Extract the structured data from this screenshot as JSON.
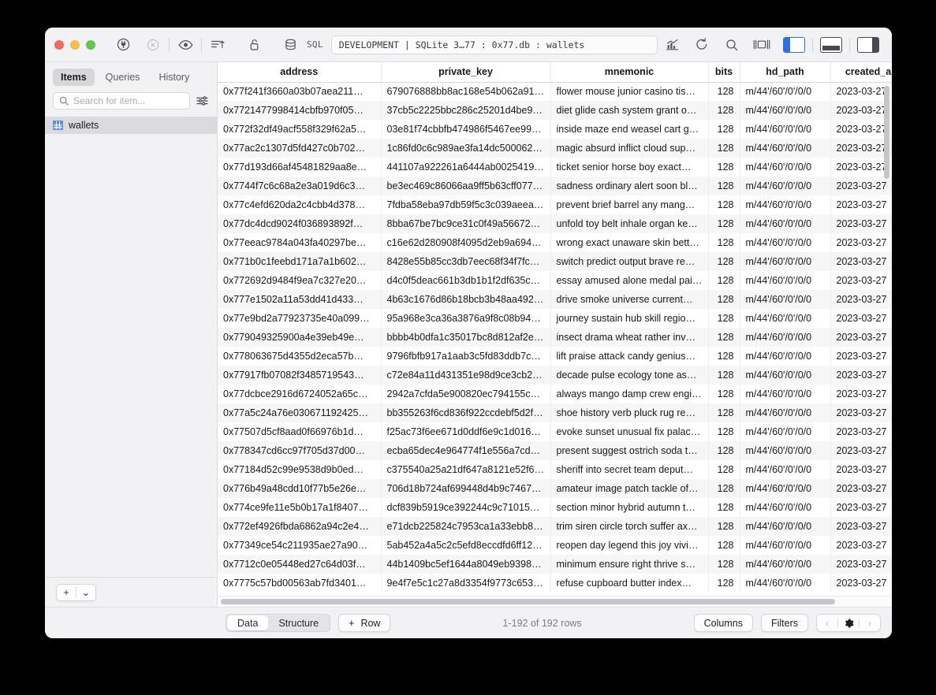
{
  "window": {
    "traffic_lights": [
      "close",
      "minimize",
      "maximize"
    ]
  },
  "toolbar": {
    "sql_label": "SQL",
    "address_value": "DEVELOPMENT | SQLite 3…77 : 0x77.db : wallets",
    "icons_left": [
      "connect-plug-icon",
      "stop-circle-icon",
      "eye-icon",
      "sort-ascending-icon",
      "unlock-icon",
      "database-icon"
    ],
    "icons_right": [
      "chart-icon",
      "refresh-icon",
      "search-icon",
      "center-panel-icon"
    ],
    "panel_toggles": [
      "left-panel-toggle",
      "bottom-panel-toggle",
      "right-panel-toggle"
    ]
  },
  "sidebar": {
    "tabs": [
      {
        "label": "Items",
        "active": true
      },
      {
        "label": "Queries",
        "active": false
      },
      {
        "label": "History",
        "active": false
      }
    ],
    "search": {
      "placeholder": "Search for item...",
      "value": ""
    },
    "filter_icon": "sliders-icon",
    "items": [
      {
        "label": "wallets",
        "icon": "table-grid-icon",
        "selected": true
      }
    ],
    "footer": {
      "add_label": "+",
      "chevron": "⌄"
    }
  },
  "table": {
    "columns": [
      {
        "key": "address",
        "label": "address"
      },
      {
        "key": "private_key",
        "label": "private_key"
      },
      {
        "key": "mnemonic",
        "label": "mnemonic"
      },
      {
        "key": "bits",
        "label": "bits"
      },
      {
        "key": "hd_path",
        "label": "hd_path"
      },
      {
        "key": "created_at",
        "label": "created_a"
      }
    ],
    "rows": [
      {
        "address": "0x77f241f3660a03b07aea211…",
        "private_key": "679076888bb8ac168e54b062a918…",
        "mnemonic": "flower mouse junior casino tis…",
        "bits": "128",
        "hd_path": "m/44'/60'/0'/0/0",
        "created_at": "2023-03-27"
      },
      {
        "address": "0x7721477998414cbfb970f05…",
        "private_key": "37cb5c2225bbc286c25201d4be966…",
        "mnemonic": "diet glide cash system grant o…",
        "bits": "128",
        "hd_path": "m/44'/60'/0'/0/0",
        "created_at": "2023-03-27"
      },
      {
        "address": "0x772f32df49acf558f329f62a5…",
        "private_key": "03e81f74cbbfb474986f5467ee99cb…",
        "mnemonic": "inside maze end weasel cart g…",
        "bits": "128",
        "hd_path": "m/44'/60'/0'/0/0",
        "created_at": "2023-03-27"
      },
      {
        "address": "0x77ac2c1307d5fd427c0b702…",
        "private_key": "1c86fd0c6c989ae3fa14dc500062b2…",
        "mnemonic": "magic absurd inflict cloud sup…",
        "bits": "128",
        "hd_path": "m/44'/60'/0'/0/0",
        "created_at": "2023-03-27"
      },
      {
        "address": "0x77d193d66af45481829aa8e…",
        "private_key": "441107a922261a6444ab00254191…",
        "mnemonic": "ticket senior horse boy exact…",
        "bits": "128",
        "hd_path": "m/44'/60'/0'/0/0",
        "created_at": "2023-03-27"
      },
      {
        "address": "0x7744f7c6c68a2e3a019d6c3…",
        "private_key": "be3ec469c86066aa9ff5b63cff0773…",
        "mnemonic": "sadness ordinary alert soon bl…",
        "bits": "128",
        "hd_path": "m/44'/60'/0'/0/0",
        "created_at": "2023-03-27"
      },
      {
        "address": "0x77c4efd620da2c4cbb4d378…",
        "private_key": "7fdba58eba97db59f5c3c039aeea67…",
        "mnemonic": "prevent brief barrel any mang…",
        "bits": "128",
        "hd_path": "m/44'/60'/0'/0/0",
        "created_at": "2023-03-27"
      },
      {
        "address": "0x77dc4dcd9024f036893892f…",
        "private_key": "8bba67be7bc9ce31c0f49a566724b…",
        "mnemonic": "unfold toy belt inhale organ ke…",
        "bits": "128",
        "hd_path": "m/44'/60'/0'/0/0",
        "created_at": "2023-03-27"
      },
      {
        "address": "0x77eeac9784a043fa40297be…",
        "private_key": "c16e62d280908f4095d2eb9a69401…",
        "mnemonic": "wrong exact unaware skin bett…",
        "bits": "128",
        "hd_path": "m/44'/60'/0'/0/0",
        "created_at": "2023-03-27"
      },
      {
        "address": "0x771b0c1feebd171a7a1b602…",
        "private_key": "8428e55b85cc3db7eec68f34f7fccdf…",
        "mnemonic": "switch predict output brave re…",
        "bits": "128",
        "hd_path": "m/44'/60'/0'/0/0",
        "created_at": "2023-03-27"
      },
      {
        "address": "0x772692d9484f9ea7c327e20…",
        "private_key": "d4c0f5deac661b3db1b1f2df635c6c…",
        "mnemonic": "essay amused alone medal pai…",
        "bits": "128",
        "hd_path": "m/44'/60'/0'/0/0",
        "created_at": "2023-03-27"
      },
      {
        "address": "0x777e1502a11a53dd41d433…",
        "private_key": "4b63c1676d86b18bcb3b48aa492d1…",
        "mnemonic": "drive smoke universe current…",
        "bits": "128",
        "hd_path": "m/44'/60'/0'/0/0",
        "created_at": "2023-03-27"
      },
      {
        "address": "0x77e9bd2a77923735e40a099…",
        "private_key": "95a968e3ca36a3876a9f8c08b947c…",
        "mnemonic": "journey sustain hub skill regio…",
        "bits": "128",
        "hd_path": "m/44'/60'/0'/0/0",
        "created_at": "2023-03-27"
      },
      {
        "address": "0x779049325900a4e39eb49e…",
        "private_key": "bbbb4b0dfa1c35017bc8d812af2e5…",
        "mnemonic": "insect drama wheat rather inv…",
        "bits": "128",
        "hd_path": "m/44'/60'/0'/0/0",
        "created_at": "2023-03-27"
      },
      {
        "address": "0x778063675d4355d2eca57b…",
        "private_key": "9796fbfb917a1aab3c5fd83ddb7ce1…",
        "mnemonic": "lift praise attack candy genius…",
        "bits": "128",
        "hd_path": "m/44'/60'/0'/0/0",
        "created_at": "2023-03-27"
      },
      {
        "address": "0x77917fb07082f3485719543…",
        "private_key": "c72e84a11d431351e98d9ce3cb241…",
        "mnemonic": "decade pulse ecology tone as…",
        "bits": "128",
        "hd_path": "m/44'/60'/0'/0/0",
        "created_at": "2023-03-27"
      },
      {
        "address": "0x77dcbce2916d6724052a65c…",
        "private_key": "2942a7cfda5e900820ec794155c1ff…",
        "mnemonic": "always mango damp crew engi…",
        "bits": "128",
        "hd_path": "m/44'/60'/0'/0/0",
        "created_at": "2023-03-27"
      },
      {
        "address": "0x77a5c24a76e030671192425…",
        "private_key": "bb355263f6cd836f922ccdebf5d2f4…",
        "mnemonic": "shoe history verb pluck rug re…",
        "bits": "128",
        "hd_path": "m/44'/60'/0'/0/0",
        "created_at": "2023-03-27"
      },
      {
        "address": "0x77507d5cf8aad0f66976b1d…",
        "private_key": "f25ac73f6ee671d0ddf6e9c1d0168f…",
        "mnemonic": "evoke sunset unusual fix palac…",
        "bits": "128",
        "hd_path": "m/44'/60'/0'/0/0",
        "created_at": "2023-03-27"
      },
      {
        "address": "0x778347cd6cc97f705d37d00…",
        "private_key": "ecba65dec4e964774f1e556a7cd5d…",
        "mnemonic": "present suggest ostrich soda t…",
        "bits": "128",
        "hd_path": "m/44'/60'/0'/0/0",
        "created_at": "2023-03-27"
      },
      {
        "address": "0x77184d52c99e9538d9b0ed…",
        "private_key": "c375540a25a21df647a8121e52f6a…",
        "mnemonic": "sheriff into secret team deput…",
        "bits": "128",
        "hd_path": "m/44'/60'/0'/0/0",
        "created_at": "2023-03-27"
      },
      {
        "address": "0x776b49a48cdd10f77b5e26e…",
        "private_key": "706d18b724af699448d4b9c746752…",
        "mnemonic": "amateur image patch tackle of…",
        "bits": "128",
        "hd_path": "m/44'/60'/0'/0/0",
        "created_at": "2023-03-27"
      },
      {
        "address": "0x774ce9fe11e5b0b17a1f8407…",
        "private_key": "dcf839b5919ce392244c9c7101539…",
        "mnemonic": "section minor hybrid autumn t…",
        "bits": "128",
        "hd_path": "m/44'/60'/0'/0/0",
        "created_at": "2023-03-27"
      },
      {
        "address": "0x772ef4926fbda6862a94c2e4…",
        "private_key": "e71dcb225824c7953ca1a33ebb82c…",
        "mnemonic": "trim siren circle torch suffer ax…",
        "bits": "128",
        "hd_path": "m/44'/60'/0'/0/0",
        "created_at": "2023-03-27"
      },
      {
        "address": "0x77349ce54c211935ae27a90…",
        "private_key": "5ab452a4a5c2c5efd8eccdfd6ff12d1…",
        "mnemonic": "reopen day legend this joy vivi…",
        "bits": "128",
        "hd_path": "m/44'/60'/0'/0/0",
        "created_at": "2023-03-27"
      },
      {
        "address": "0x7712c0e05448ed27c64d03f…",
        "private_key": "44b1409bc5ef1644a8049eb939894…",
        "mnemonic": "minimum ensure right thrive s…",
        "bits": "128",
        "hd_path": "m/44'/60'/0'/0/0",
        "created_at": "2023-03-27"
      },
      {
        "address": "0x7775c57bd00563ab7fd3401…",
        "private_key": "9e4f7e5c1c27a8d3354f9773c653fd…",
        "mnemonic": "refuse cupboard butter index…",
        "bits": "128",
        "hd_path": "m/44'/60'/0'/0/0",
        "created_at": "2023-03-27"
      }
    ]
  },
  "bottom_bar": {
    "view_tabs": [
      {
        "label": "Data",
        "active": true
      },
      {
        "label": "Structure",
        "active": false
      }
    ],
    "add_row_label": "Row",
    "add_row_plus": "+",
    "row_count": "1-192 of 192 rows",
    "columns_label": "Columns",
    "filters_label": "Filters",
    "nav": {
      "prev": "‹",
      "gear": "gear-icon",
      "next": "›"
    }
  }
}
